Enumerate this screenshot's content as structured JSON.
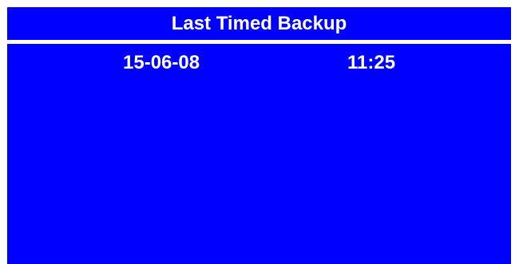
{
  "title": "Last Timed Backup",
  "backup": {
    "date": "15-06-08",
    "time": "11:25"
  },
  "colors": {
    "background": "#0000ff",
    "text": "#ffffff",
    "divider": "#ffffff"
  }
}
